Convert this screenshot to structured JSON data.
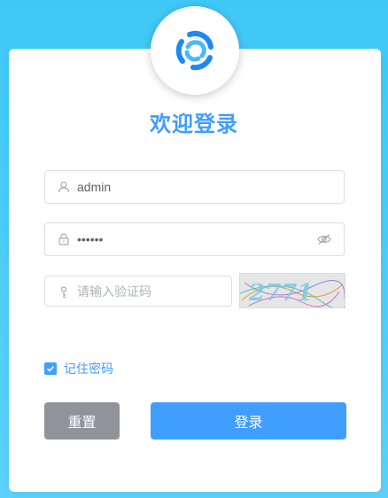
{
  "title": "欢迎登录",
  "username": {
    "value": "admin",
    "icon": "user-icon"
  },
  "password": {
    "value": "••••••",
    "icon": "lock-icon",
    "toggle_icon": "eye-icon"
  },
  "captcha": {
    "placeholder": "请输入验证码",
    "icon": "key-icon",
    "image_text": "2771"
  },
  "remember": {
    "label": "记住密码",
    "checked": true
  },
  "buttons": {
    "reset": "重置",
    "login": "登录"
  },
  "colors": {
    "primary": "#409eff",
    "background": "#3fc8f6",
    "reset_button": "#909399"
  }
}
